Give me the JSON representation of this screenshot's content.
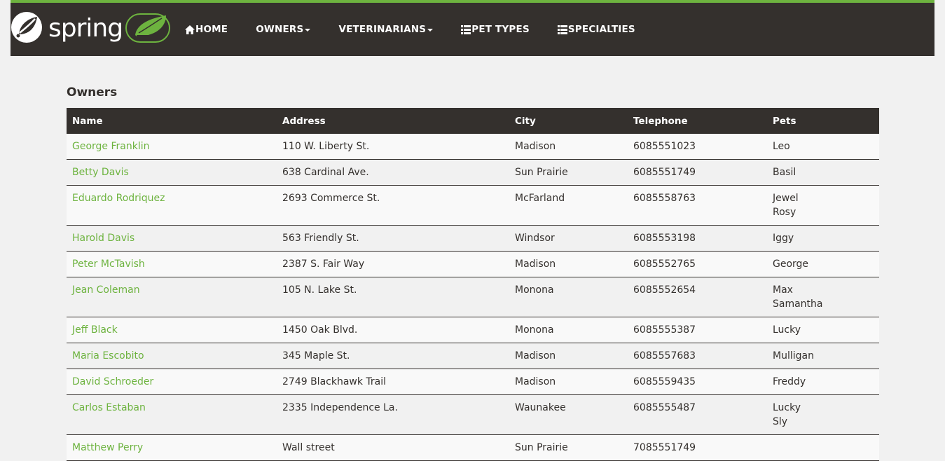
{
  "brand": {
    "name": "spring",
    "accent_color": "#6db33f",
    "navbar_color": "#34302d"
  },
  "nav": {
    "home": "HOME",
    "owners": "OWNERS",
    "veterinarians": "VETERINARIANS",
    "pet_types": "PET TYPES",
    "specialties": "SPECIALTIES"
  },
  "page": {
    "title": "Owners"
  },
  "table": {
    "headers": [
      "Name",
      "Address",
      "City",
      "Telephone",
      "Pets"
    ],
    "rows": [
      {
        "name": "George Franklin",
        "address": "110 W. Liberty St.",
        "city": "Madison",
        "telephone": "6085551023",
        "pets": [
          "Leo"
        ]
      },
      {
        "name": "Betty Davis",
        "address": "638 Cardinal Ave.",
        "city": "Sun Prairie",
        "telephone": "6085551749",
        "pets": [
          "Basil"
        ]
      },
      {
        "name": "Eduardo Rodriquez",
        "address": "2693 Commerce St.",
        "city": "McFarland",
        "telephone": "6085558763",
        "pets": [
          "Jewel",
          "Rosy"
        ]
      },
      {
        "name": "Harold Davis",
        "address": "563 Friendly St.",
        "city": "Windsor",
        "telephone": "6085553198",
        "pets": [
          "Iggy"
        ]
      },
      {
        "name": "Peter McTavish",
        "address": "2387 S. Fair Way",
        "city": "Madison",
        "telephone": "6085552765",
        "pets": [
          "George"
        ]
      },
      {
        "name": "Jean Coleman",
        "address": "105 N. Lake St.",
        "city": "Monona",
        "telephone": "6085552654",
        "pets": [
          "Max",
          "Samantha"
        ]
      },
      {
        "name": "Jeff Black",
        "address": "1450 Oak Blvd.",
        "city": "Monona",
        "telephone": "6085555387",
        "pets": [
          "Lucky"
        ]
      },
      {
        "name": "Maria Escobito",
        "address": "345 Maple St.",
        "city": "Madison",
        "telephone": "6085557683",
        "pets": [
          "Mulligan"
        ]
      },
      {
        "name": "David Schroeder",
        "address": "2749 Blackhawk Trail",
        "city": "Madison",
        "telephone": "6085559435",
        "pets": [
          "Freddy"
        ]
      },
      {
        "name": "Carlos Estaban",
        "address": "2335 Independence La.",
        "city": "Waunakee",
        "telephone": "6085555487",
        "pets": [
          "Lucky",
          "Sly"
        ]
      },
      {
        "name": "Matthew Perry",
        "address": "Wall street",
        "city": "Sun Prairie",
        "telephone": "7085551749",
        "pets": []
      }
    ]
  }
}
